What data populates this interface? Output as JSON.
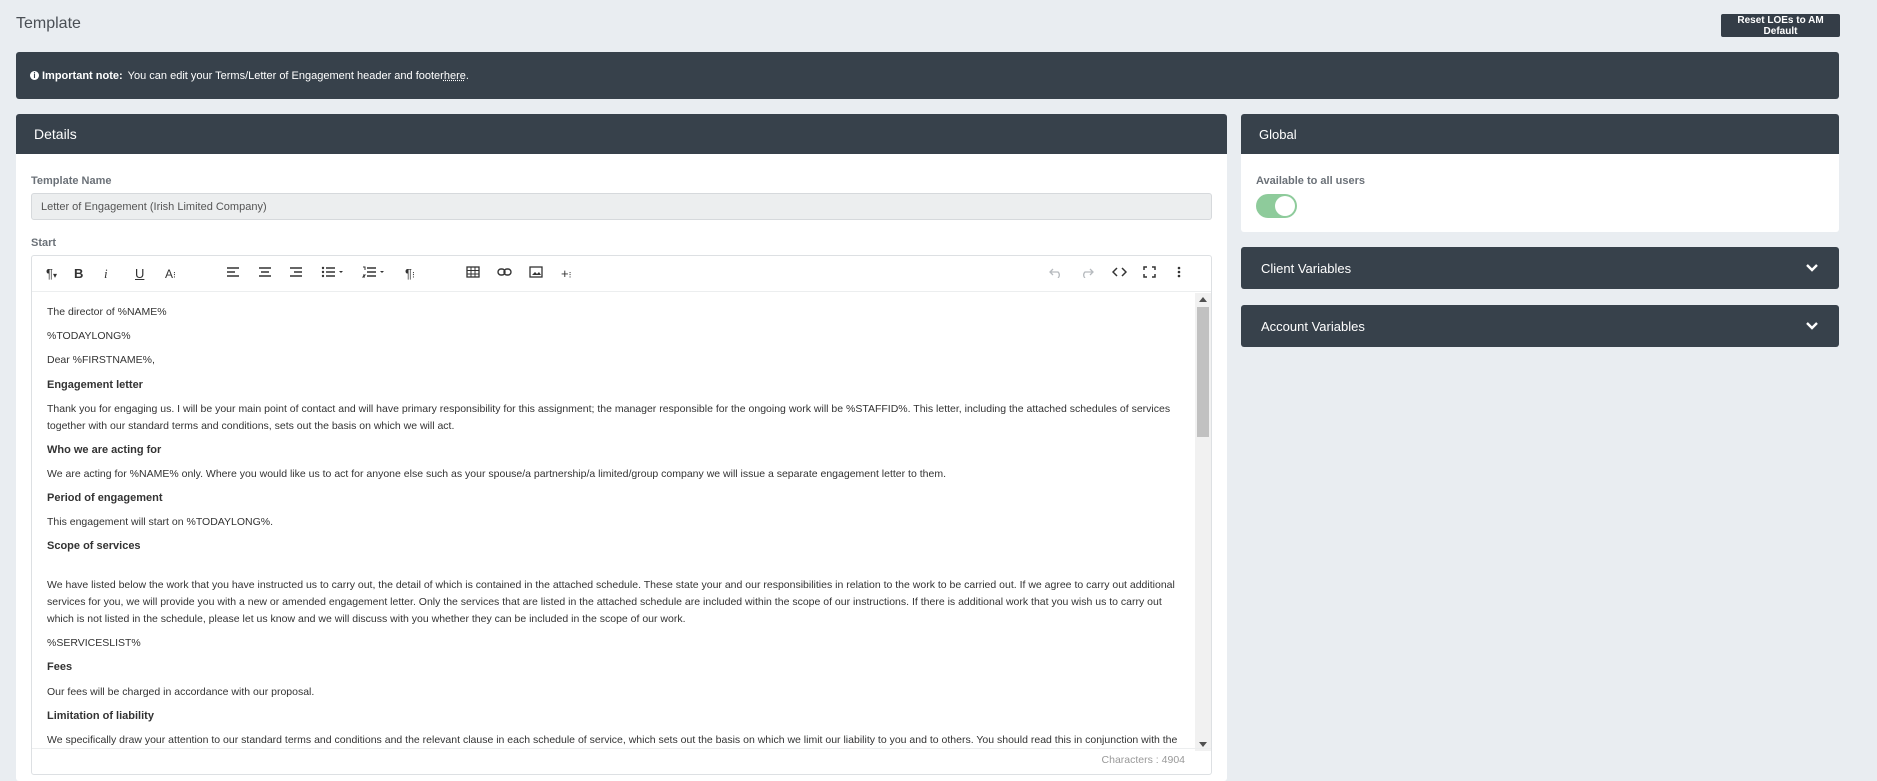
{
  "page": {
    "title": "Template"
  },
  "actions": {
    "reset_label": "Reset LOEs to AM Default"
  },
  "notice": {
    "icon": "info-circle-icon",
    "bold": "Important note:",
    "text": "You can edit your Terms/Letter of Engagement header and footer ",
    "link": "here",
    "trail": "."
  },
  "details": {
    "title": "Details",
    "template_name_label": "Template Name",
    "template_name_value": "Letter of Engagement (Irish Limited Company)",
    "start_label": "Start",
    "toolbar": {
      "left": [
        "paragraph-format-icon",
        "bold-icon",
        "italic-icon",
        "underline-icon",
        "font-size-icon",
        "align-left-icon",
        "align-center-icon",
        "align-right-icon",
        "unordered-list-icon",
        "ordered-list-icon",
        "paragraph-style-icon",
        "insert-table-icon",
        "insert-link-icon",
        "insert-image-icon",
        "more-plus-icon"
      ],
      "right": [
        "undo-icon",
        "redo-icon",
        "code-view-icon",
        "fullscreen-icon",
        "more-vertical-icon"
      ]
    },
    "content": [
      {
        "type": "p",
        "text": "The director of %NAME%"
      },
      {
        "type": "p",
        "text": "%TODAYLONG%"
      },
      {
        "type": "p",
        "text": "Dear %FIRSTNAME%,"
      },
      {
        "type": "h",
        "text": "Engagement letter"
      },
      {
        "type": "p",
        "text": "Thank you for engaging us. I will be your main point of contact and will have primary responsibility for this assignment; the manager responsible for the ongoing work will be %STAFFID%. This letter, including the attached schedules of services together with our standard terms and conditions, sets out the basis on which we will act."
      },
      {
        "type": "h",
        "text": "Who we are acting for"
      },
      {
        "type": "p",
        "text": "We are acting for %NAME% only. Where you would like us to act for anyone else such as your spouse/a partnership/a limited/group company we will issue a separate engagement letter to them."
      },
      {
        "type": "h",
        "text": "Period of engagement"
      },
      {
        "type": "p",
        "text": "This engagement will start on %TODAYLONG%."
      },
      {
        "type": "h",
        "text": "Scope of services"
      },
      {
        "type": "p",
        "text": "We have listed below the work that you have instructed us to carry out, the detail of which is contained in the attached schedule. These state your and our responsibilities in relation to the work to be carried out. If we agree to carry out additional services for you, we will provide you with a new or amended engagement letter. Only the services that are listed in the attached schedule are included within the scope of our instructions. If there is additional work that you wish us to carry out which is not listed in the schedule, please let us know and we will discuss with you whether they can be included in the scope of our work."
      },
      {
        "type": "p",
        "text": "%SERVICESLIST%"
      },
      {
        "type": "h",
        "text": "Fees"
      },
      {
        "type": "p",
        "text": "Our fees will be charged in accordance with our proposal."
      },
      {
        "type": "h",
        "text": "Limitation of liability"
      },
      {
        "type": "p",
        "text": "We specifically draw your attention to our standard terms and conditions and the relevant clause in each schedule of service, which sets out the basis on which we limit our liability to you and to others. You should read this in conjunction with the"
      }
    ],
    "char_count": "Characters : 4904"
  },
  "global": {
    "title": "Global",
    "available_label": "Available to all users",
    "available_on": true
  },
  "accordions": {
    "client": "Client Variables",
    "account": "Account Variables"
  },
  "colors": {
    "header": "#37414b",
    "toggle_on": "#8ecb9b",
    "background": "#e9edf1"
  }
}
